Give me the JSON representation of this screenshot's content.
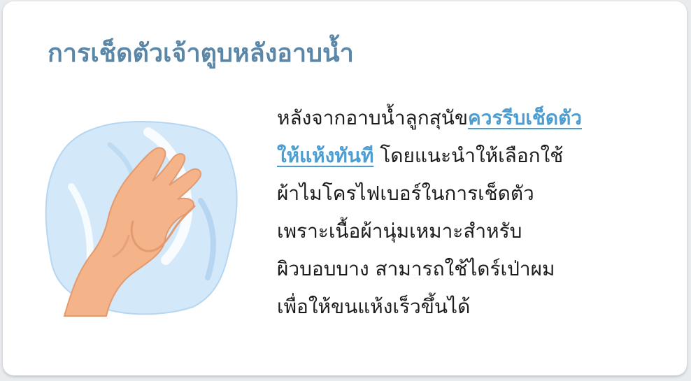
{
  "card": {
    "title": "การเช็ดตัวเจ้าตูบหลังอาบน้ำ",
    "illustration": "towel-and-hand-icon",
    "body": {
      "line1_text": "หลังจากอาบน้ำลูกสุนัข",
      "line1_highlight": "ควรรีบเช็ดตัว",
      "line2_highlight": "ให้แห้งทันที",
      "line2_text": " โดยแนะนำให้เลือกใช้",
      "line3": "ผ้าไมโครไฟเบอร์ในการเช็ดตัว",
      "line4": "เพราะเนื้อผ้านุ่มเหมาะสำหรับ",
      "line5": "ผิวบอบบาง สามารถใช้ไดร์เป่าผม",
      "line6": "เพื่อให้ขนแห้งเร็วขึ้นได้"
    }
  },
  "colors": {
    "title": "#5a86a8",
    "highlight": "#4d9dd1",
    "towel": "#cfe6f8",
    "skin": "#f4b389"
  }
}
